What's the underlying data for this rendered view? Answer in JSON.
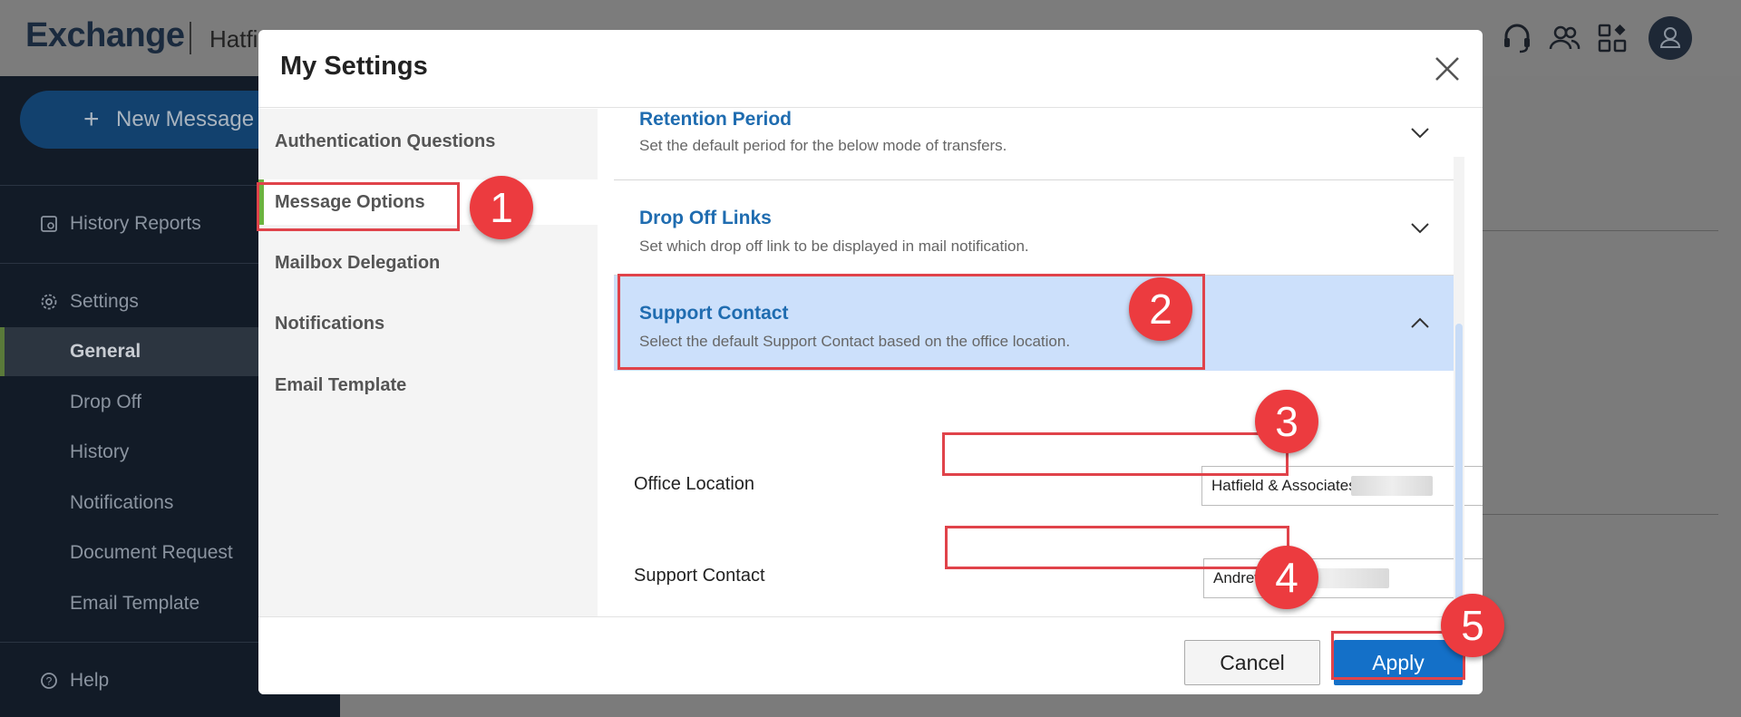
{
  "app": {
    "logo": "Exchange",
    "tenant": "Hatfi"
  },
  "top_icons": [
    "headset-icon",
    "users-icon",
    "apps-icon"
  ],
  "sidebar": {
    "new_message": "New Message",
    "history_reports": "History Reports",
    "settings": "Settings",
    "items": [
      {
        "label": "General",
        "active": true
      },
      {
        "label": "Drop Off"
      },
      {
        "label": "History"
      },
      {
        "label": "Notifications"
      },
      {
        "label": "Document Request"
      },
      {
        "label": "Email Template"
      }
    ],
    "help": "Help"
  },
  "modal": {
    "title": "My Settings",
    "nav": [
      "Authentication Questions",
      "Message Options",
      "Mailbox Delegation",
      "Notifications",
      "Email Template"
    ],
    "sections": {
      "retention": {
        "title": "Retention Period",
        "desc": "Set the default period for the below mode of transfers."
      },
      "dropoff": {
        "title": "Drop Off Links",
        "desc": "Set which drop off link to be displayed in mail notification."
      },
      "support": {
        "title": "Support Contact",
        "desc": "Select the default Support Contact based on the office location."
      }
    },
    "form": {
      "office_label": "Office Location",
      "office_value": "Hatfield & Associates",
      "contact_label": "Support Contact",
      "contact_value": "Andrew"
    },
    "buttons": {
      "cancel": "Cancel",
      "apply": "Apply"
    }
  },
  "annotations": [
    "1",
    "2",
    "3",
    "4",
    "5"
  ],
  "colors": {
    "accent": "#1470c8",
    "annotation": "#ec3b3f",
    "nav_active": "#6cb33f",
    "open_section": "#cce0fb"
  }
}
